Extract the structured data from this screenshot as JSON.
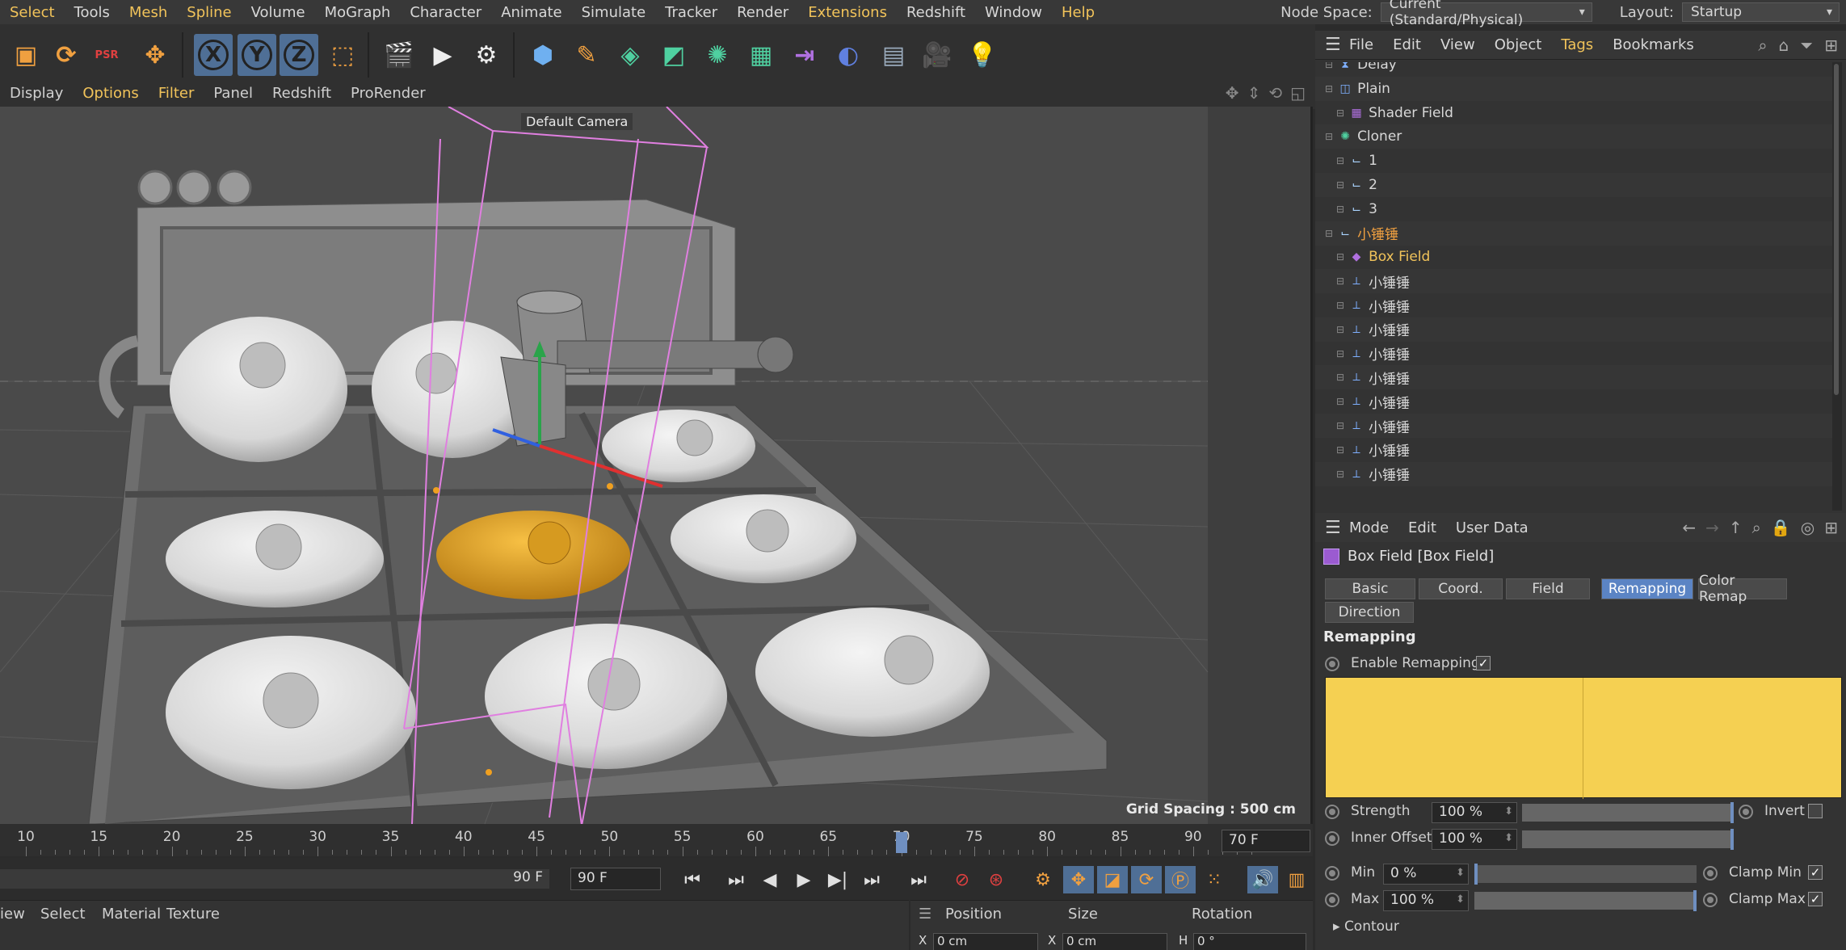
{
  "menubar": {
    "items": [
      "Select",
      "Tools",
      "Mesh",
      "Spline",
      "Volume",
      "MoGraph",
      "Character",
      "Animate",
      "Simulate",
      "Tracker",
      "Render",
      "Extensions",
      "Redshift",
      "Window",
      "Help"
    ],
    "highlighted": [
      "Select",
      "Mesh",
      "Spline",
      "Extensions",
      "Help"
    ],
    "node_space_label": "Node Space:",
    "node_space_value": "Current (Standard/Physical)",
    "layout_label": "Layout:",
    "layout_value": "Startup"
  },
  "toolbar": {
    "buttons": [
      {
        "name": "select-mode-icon",
        "glyph": "▣"
      },
      {
        "name": "rotate-tool-icon",
        "glyph": "⟳"
      },
      {
        "name": "psr-icon",
        "glyph": "PSR"
      },
      {
        "name": "move-tool-icon",
        "glyph": "✥"
      },
      {
        "name": "x-axis-lock-icon",
        "glyph": "X"
      },
      {
        "name": "y-axis-lock-icon",
        "glyph": "Y"
      },
      {
        "name": "z-axis-lock-icon",
        "glyph": "Z"
      },
      {
        "name": "coordinate-system-icon",
        "glyph": "⬚"
      },
      {
        "name": "render-region-icon",
        "glyph": "🎬"
      },
      {
        "name": "render-view-icon",
        "glyph": "▶"
      },
      {
        "name": "render-settings-icon",
        "glyph": "⚙"
      },
      {
        "name": "cube-primitive-icon",
        "glyph": "⬢"
      },
      {
        "name": "pen-tool-icon",
        "glyph": "✎"
      },
      {
        "name": "subdivision-icon",
        "glyph": "◈"
      },
      {
        "name": "extrude-icon",
        "glyph": "◩"
      },
      {
        "name": "cloner-icon",
        "glyph": "✺"
      },
      {
        "name": "mograph-icon",
        "glyph": "▦"
      },
      {
        "name": "deformer-icon",
        "glyph": "⇥"
      },
      {
        "name": "field-icon",
        "glyph": "◐"
      },
      {
        "name": "floor-icon",
        "glyph": "▤"
      },
      {
        "name": "camera-icon",
        "glyph": "🎥"
      },
      {
        "name": "light-icon",
        "glyph": "💡"
      }
    ]
  },
  "viewport": {
    "menu": [
      "Display",
      "Options",
      "Filter",
      "Panel",
      "Redshift",
      "ProRender"
    ],
    "highlighted": [
      "Options",
      "Filter"
    ],
    "camera_label": "Default Camera",
    "grid_label": "Grid Spacing : 500 cm"
  },
  "timeline": {
    "ticks": [
      "10",
      "15",
      "20",
      "25",
      "30",
      "35",
      "40",
      "45",
      "50",
      "55",
      "60",
      "65",
      "70",
      "75",
      "80",
      "85",
      "90"
    ],
    "current_frame": "70 F",
    "current_frame_value": 70
  },
  "transport": {
    "end_frame_a": "90 F",
    "end_frame_b": "90 F"
  },
  "material_bar": {
    "items": [
      "iew",
      "Select",
      "Material",
      "Texture"
    ]
  },
  "coord_bar": {
    "headers": [
      "Position",
      "Size",
      "Rotation"
    ],
    "fields": [
      "X",
      "0 cm",
      "X",
      "0 cm",
      "H",
      "0 °"
    ]
  },
  "object_manager": {
    "menu": [
      "File",
      "Edit",
      "View",
      "Object",
      "Tags",
      "Bookmarks"
    ],
    "highlighted": [
      "Tags"
    ],
    "rows": [
      {
        "name": "Delay",
        "indent": 1,
        "icon": "delay-icon",
        "check": true,
        "color": "#d8d8d8"
      },
      {
        "name": "Plain",
        "indent": 1,
        "icon": "plain-effector-icon",
        "check": true,
        "color": "#d8d8d8"
      },
      {
        "name": "Shader Field",
        "indent": 2,
        "icon": "shader-field-icon",
        "check": true,
        "color": "#d8d8d8"
      },
      {
        "name": "Cloner",
        "indent": 1,
        "icon": "cloner-icon",
        "check": true,
        "color": "#d8d8d8"
      },
      {
        "name": "1",
        "indent": 2,
        "icon": "null-icon",
        "check": false,
        "color": "#d8d8d8"
      },
      {
        "name": "2",
        "indent": 2,
        "icon": "null-icon",
        "check": false,
        "color": "#d8d8d8"
      },
      {
        "name": "3",
        "indent": 2,
        "icon": "null-icon",
        "check": false,
        "color": "#d8d8d8"
      },
      {
        "name": "小锤锤",
        "indent": 1,
        "icon": "null-icon",
        "check": false,
        "color": "#f0a040"
      },
      {
        "name": "Box Field",
        "indent": 2,
        "icon": "box-field-icon",
        "check": true,
        "color": "#f1c35a"
      },
      {
        "name": "小锤锤",
        "indent": 2,
        "icon": "joint-icon",
        "check": false,
        "color": "#d8d8d8",
        "tags": [
          "dot",
          "checker"
        ]
      },
      {
        "name": "小锤锤",
        "indent": 2,
        "icon": "joint-icon",
        "check": false,
        "color": "#d8d8d8",
        "tags": [
          "checker",
          "dot"
        ]
      },
      {
        "name": "小锤锤",
        "indent": 2,
        "icon": "joint-icon",
        "check": false,
        "color": "#d8d8d8",
        "tags": [
          "dot",
          "checker"
        ]
      },
      {
        "name": "小锤锤",
        "indent": 2,
        "icon": "joint-icon",
        "check": false,
        "color": "#d8d8d8",
        "tags": [
          "dot",
          "checker"
        ]
      },
      {
        "name": "小锤锤",
        "indent": 2,
        "icon": "joint-icon",
        "check": false,
        "color": "#d8d8d8",
        "tags": [
          "dot",
          "checker"
        ]
      },
      {
        "name": "小锤锤",
        "indent": 2,
        "icon": "joint-icon",
        "check": false,
        "color": "#d8d8d8",
        "tags": [
          "dot",
          "checker"
        ]
      },
      {
        "name": "小锤锤",
        "indent": 2,
        "icon": "joint-icon",
        "check": false,
        "color": "#d8d8d8",
        "tags": [
          "dot",
          "checker"
        ]
      },
      {
        "name": "小锤锤",
        "indent": 2,
        "icon": "joint-icon",
        "check": false,
        "color": "#d8d8d8",
        "tags": [
          "dot",
          "checker"
        ]
      },
      {
        "name": "小锤锤",
        "indent": 2,
        "icon": "joint-icon",
        "check": false,
        "color": "#d8d8d8",
        "tags": [
          "dot",
          "checker"
        ]
      }
    ]
  },
  "attribute_manager": {
    "menu": [
      "Mode",
      "Edit",
      "User Data"
    ],
    "title": "Box Field [Box Field]",
    "tabs": [
      "Basic",
      "Coord.",
      "Field",
      "Remapping",
      "Color Remap",
      "Direction"
    ],
    "active_tab": "Remapping",
    "section": "Remapping",
    "enable_remapping_label": "Enable Remapping",
    "enable_remapping": true,
    "curve_color": "#f5d052",
    "strength_label": "Strength",
    "strength_value": "100 %",
    "strength_fraction": 1.0,
    "invert_label": "Invert",
    "invert": false,
    "inner_offset_label": "Inner Offset",
    "inner_offset_value": "100 %",
    "inner_offset_fraction": 1.0,
    "min_label": "Min",
    "min_value": "0 %",
    "min_fraction": 0.0,
    "clamp_min_label": "Clamp Min",
    "clamp_min": true,
    "max_label": "Max",
    "max_value": "100 %",
    "max_fraction": 1.0,
    "clamp_max_label": "Clamp Max",
    "clamp_max": true,
    "contour_label": "Contour"
  },
  "colors": {
    "accent_yellow": "#f1c35a",
    "selection_blue": "#5b84c4",
    "highlight_orange": "#e8a020",
    "check_green": "#6fd16f"
  }
}
